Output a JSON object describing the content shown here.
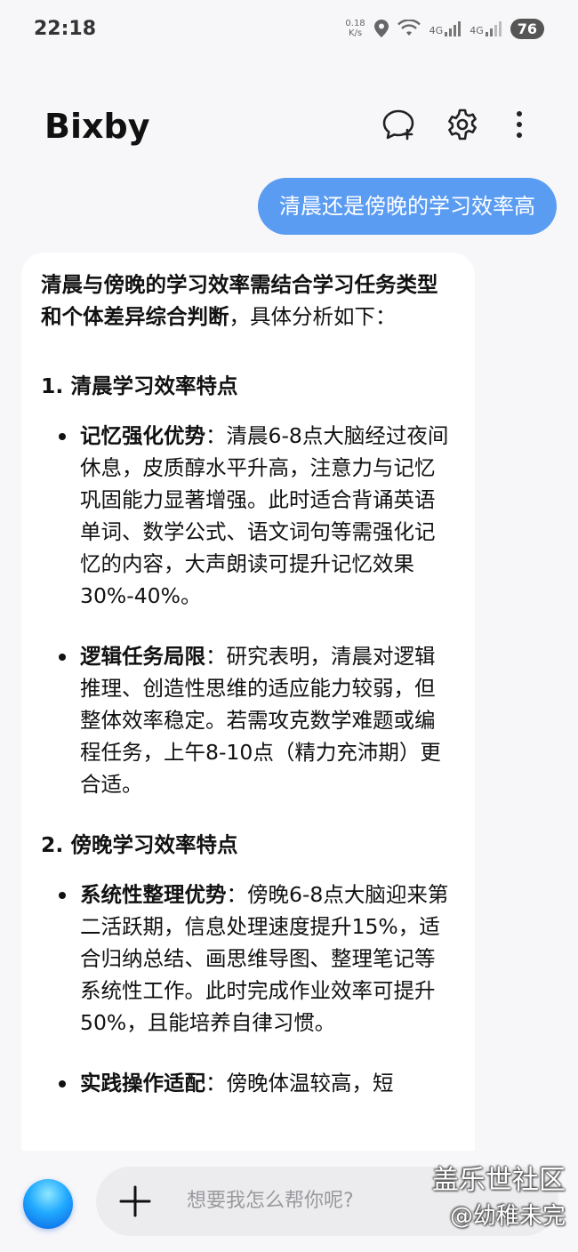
{
  "status_bar": {
    "time": "22:18",
    "net_speed_value": "0.18",
    "net_speed_unit": "K/s",
    "signal1_label": "4G",
    "signal2_label": "4G",
    "battery": "76"
  },
  "header": {
    "title": "Bixby",
    "icons": [
      "new-chat-icon",
      "gear-icon",
      "more-vertical-icon"
    ]
  },
  "chat": {
    "user_message": "清晨还是傍晚的学习效率高",
    "reply": {
      "intro_bold": "清晨与傍晚的学习效率需结合学习任务类型和个体差异综合判断",
      "intro_rest": "，具体分析如下：",
      "section1_title": "1. 清晨学习效率特点",
      "section1_points": [
        {
          "label": "记忆强化优势",
          "text": "：清晨6-8点大脑经过夜间休息，皮质醇水平升高，注意力与记忆巩固能力显著增强。此时适合背诵英语单词、数学公式、语文词句等需强化记忆的内容，大声朗读可提升记忆效果30%-40%。"
        },
        {
          "label": "逻辑任务局限",
          "text": "：研究表明，清晨对逻辑推理、创造性思维的适应能力较弱，但整体效率稳定。若需攻克数学难题或编程任务，上午8-10点（精力充沛期）更合适。"
        }
      ],
      "section2_title": "2. 傍晚学习效率特点",
      "section2_points": [
        {
          "label": "系统性整理优势",
          "text": "：傍晚6-8点大脑迎来第二活跃期，信息处理速度提升15%，适合归纳总结、画思维导图、整理笔记等系统性工作。此时完成作业效率可提升50%，且能培养自律习惯。"
        },
        {
          "label": "实践操作适配",
          "text": "：傍晚体温较高，短"
        }
      ]
    }
  },
  "input": {
    "placeholder": "想要我怎么帮你呢?"
  },
  "watermark": {
    "line1": "盖乐世社区",
    "line2": "@幼稚未完"
  },
  "colors": {
    "user_bubble": "#5b9cf3",
    "background": "#f7f7f9",
    "card": "#ffffff"
  }
}
